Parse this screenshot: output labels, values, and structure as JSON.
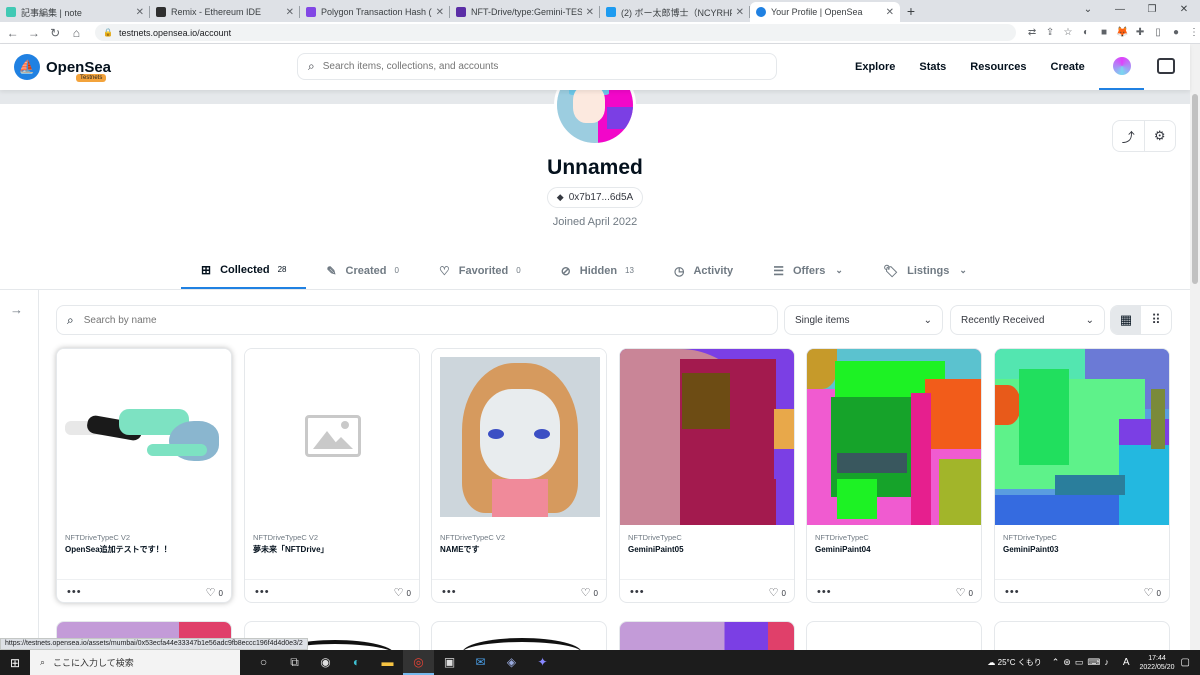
{
  "browser": {
    "tabs": [
      {
        "title": "記事編集 | note",
        "color": "#41c9b4"
      },
      {
        "title": "Remix - Ethereum IDE",
        "color": "#2f2f2f"
      },
      {
        "title": "Polygon Transaction Hash (Txhas",
        "color": "#8247e5"
      },
      {
        "title": "NFT-Drive/type:Gemini-TEST_NI",
        "color": "#5b2ea6"
      },
      {
        "title": "(2) ボー太郎博士（NCYRHFYAW?",
        "color": "#1d9bf0"
      },
      {
        "title": "Your Profile | OpenSea",
        "color": "#2081e2",
        "active": true
      }
    ],
    "new_tab": "+",
    "url": "testnets.opensea.io/account",
    "status_url": "https://testnets.opensea.io/assets/mumbai/0x53ecfa44e33347b1e56adc9fb8eccc196f4d4d0e3/2"
  },
  "header": {
    "logo_text": "OpenSea",
    "badge": "Testnets",
    "search_placeholder": "Search items, collections, and accounts",
    "menu": [
      "Explore",
      "Stats",
      "Resources",
      "Create"
    ]
  },
  "profile": {
    "name": "Unnamed",
    "address": "0x7b17...6d5A",
    "joined": "Joined April 2022"
  },
  "tabs": [
    {
      "label": "Collected",
      "count": "28",
      "icon": "collected-icon",
      "active": true
    },
    {
      "label": "Created",
      "count": "0",
      "icon": "brush-icon"
    },
    {
      "label": "Favorited",
      "count": "0",
      "icon": "heart-icon"
    },
    {
      "label": "Hidden",
      "count": "13",
      "icon": "eye-off-icon"
    },
    {
      "label": "Activity",
      "count": "",
      "icon": "history-icon"
    },
    {
      "label": "Offers",
      "count": "",
      "icon": "list-icon",
      "dropdown": true
    },
    {
      "label": "Listings",
      "count": "",
      "icon": "tag-icon",
      "dropdown": true
    }
  ],
  "filters": {
    "search_placeholder": "Search by name",
    "type_select": "Single items",
    "sort_select": "Recently Received"
  },
  "cards": [
    {
      "collection": "NFTDriveTypeC V2",
      "title": "OpenSea追加テストです！！",
      "likes": "0"
    },
    {
      "collection": "NFTDriveTypeC V2",
      "title": "夢未来「NFTDrive」",
      "likes": "0"
    },
    {
      "collection": "NFTDriveTypeC V2",
      "title": "NAMEです",
      "likes": "0"
    },
    {
      "collection": "NFTDriveTypeC",
      "title": "GeminiPaint05",
      "likes": "0"
    },
    {
      "collection": "NFTDriveTypeC",
      "title": "GeminiPaint04",
      "likes": "0"
    },
    {
      "collection": "NFTDriveTypeC",
      "title": "GeminiPaint03",
      "likes": "0"
    }
  ],
  "taskbar": {
    "search_placeholder": "ここに入力して検索",
    "weather": "25°C くもり",
    "time": "17:44",
    "date": "2022/05/20",
    "ime": "A"
  }
}
